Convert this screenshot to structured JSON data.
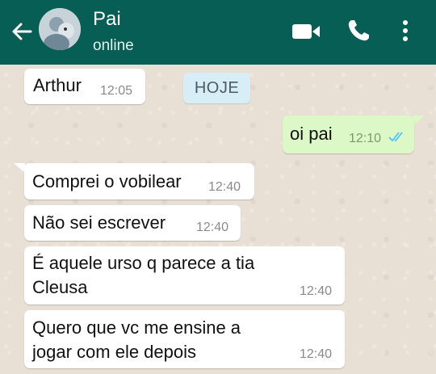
{
  "header": {
    "contact_name": "Pai",
    "status": "online",
    "colors": {
      "bar": "#075e54"
    },
    "icons": [
      "back-arrow-icon",
      "avatar",
      "video-call-icon",
      "phone-icon",
      "more-options-icon"
    ]
  },
  "date_separator": "HOJE",
  "messages": [
    {
      "direction": "in",
      "text": "Arthur",
      "time": "12:05"
    },
    {
      "direction": "out",
      "text": "oi pai",
      "time": "12:10",
      "status_icon": "double-check-icon"
    },
    {
      "direction": "in",
      "text": "Comprei o vobilear",
      "time": "12:40"
    },
    {
      "direction": "in",
      "text": "Não sei escrever",
      "time": "12:40"
    },
    {
      "direction": "in",
      "text": "É aquele urso q parece a tia\nCleusa",
      "time": "12:40"
    },
    {
      "direction": "in",
      "text": "Quero que vc me ensine a\njogar com ele depois",
      "time": "12:40"
    }
  ]
}
